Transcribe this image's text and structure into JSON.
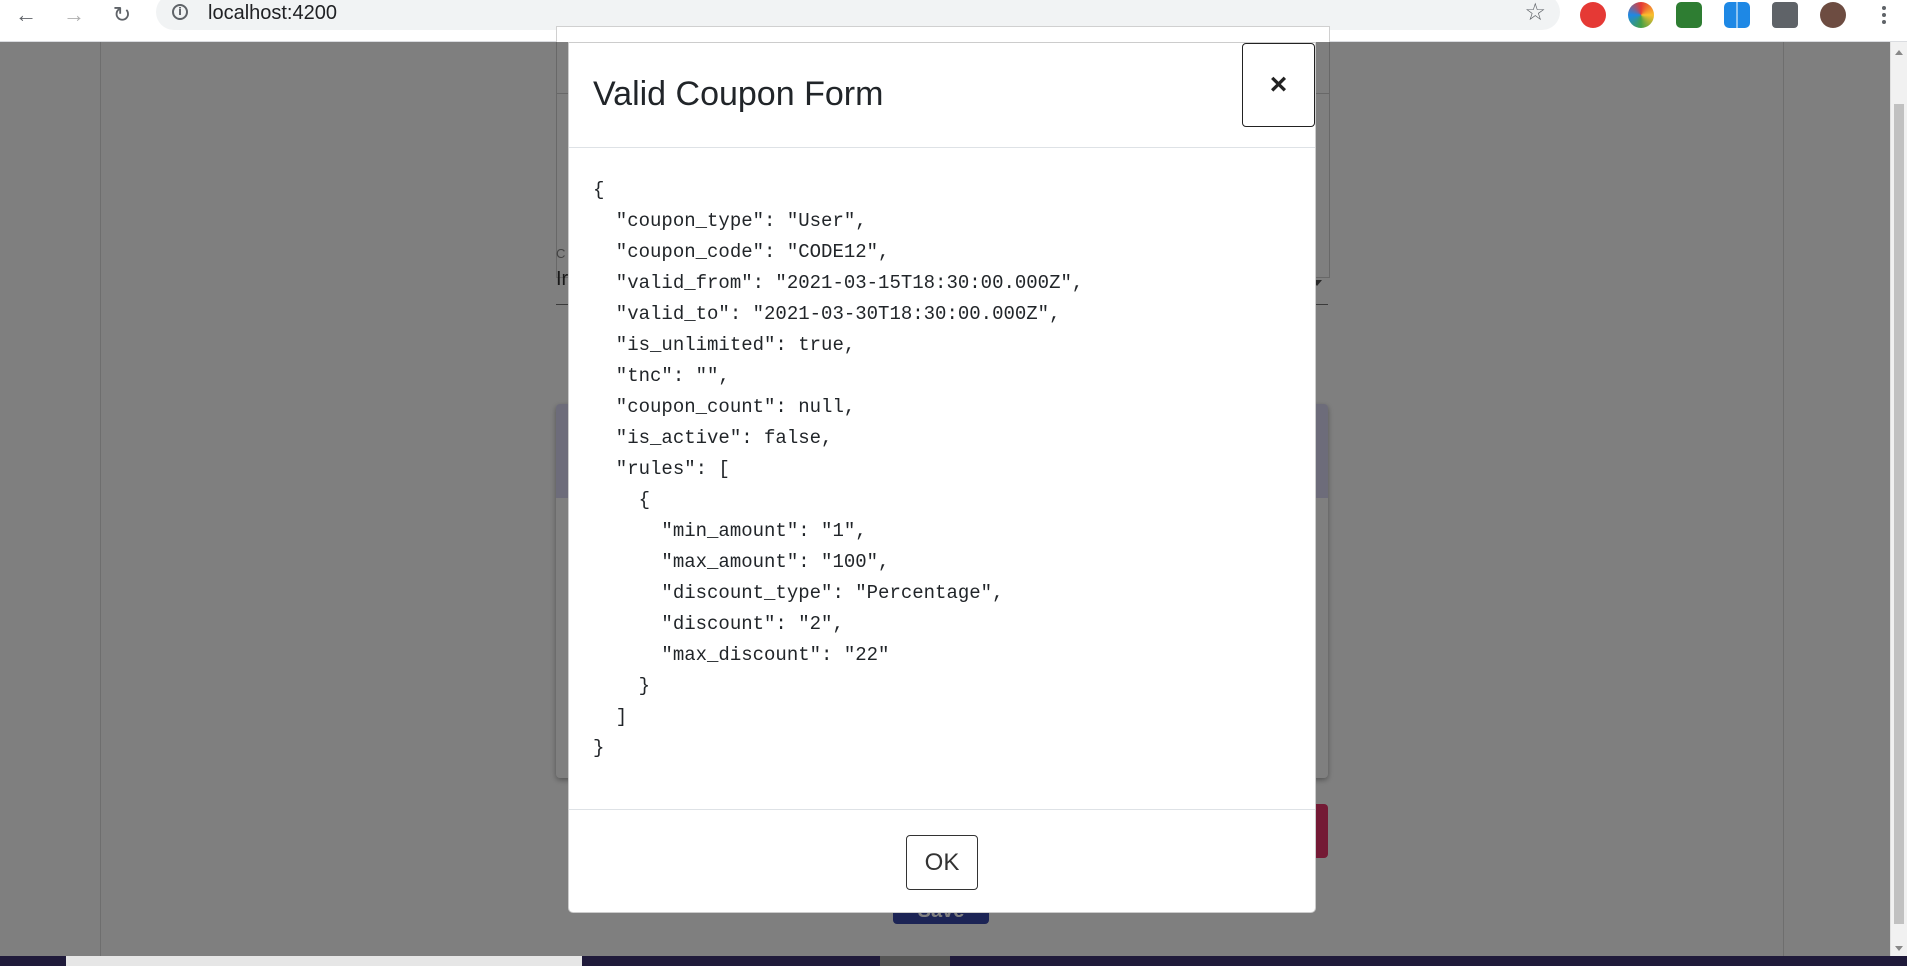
{
  "browser": {
    "url": "localhost:4200",
    "icons": {
      "back": "back-arrow-icon",
      "forward": "forward-arrow-icon",
      "reload": "reload-icon",
      "info": "site-info-icon",
      "bookmark": "star-icon"
    }
  },
  "modal": {
    "title": "Valid Coupon Form",
    "close_label": "×",
    "body_json": "{\n  \"coupon_type\": \"User\",\n  \"coupon_code\": \"CODE12\",\n  \"valid_from\": \"2021-03-15T18:30:00.000Z\",\n  \"valid_to\": \"2021-03-30T18:30:00.000Z\",\n  \"is_unlimited\": true,\n  \"tnc\": \"\",\n  \"coupon_count\": null,\n  \"is_active\": false,\n  \"rules\": [\n    {\n      \"min_amount\": \"1\",\n      \"max_amount\": \"100\",\n      \"discount_type\": \"Percentage\",\n      \"discount\": \"2\",\n      \"max_discount\": \"22\"\n    }\n  ]\n}",
    "ok_label": "OK"
  },
  "background": {
    "field_label": "C",
    "field_value": "Ir",
    "save_label": "Save"
  },
  "colors": {
    "backdrop": "#808080",
    "save_button": "#3949ab",
    "red_button": "#e8346a",
    "panel_band": "#dad8f4"
  }
}
